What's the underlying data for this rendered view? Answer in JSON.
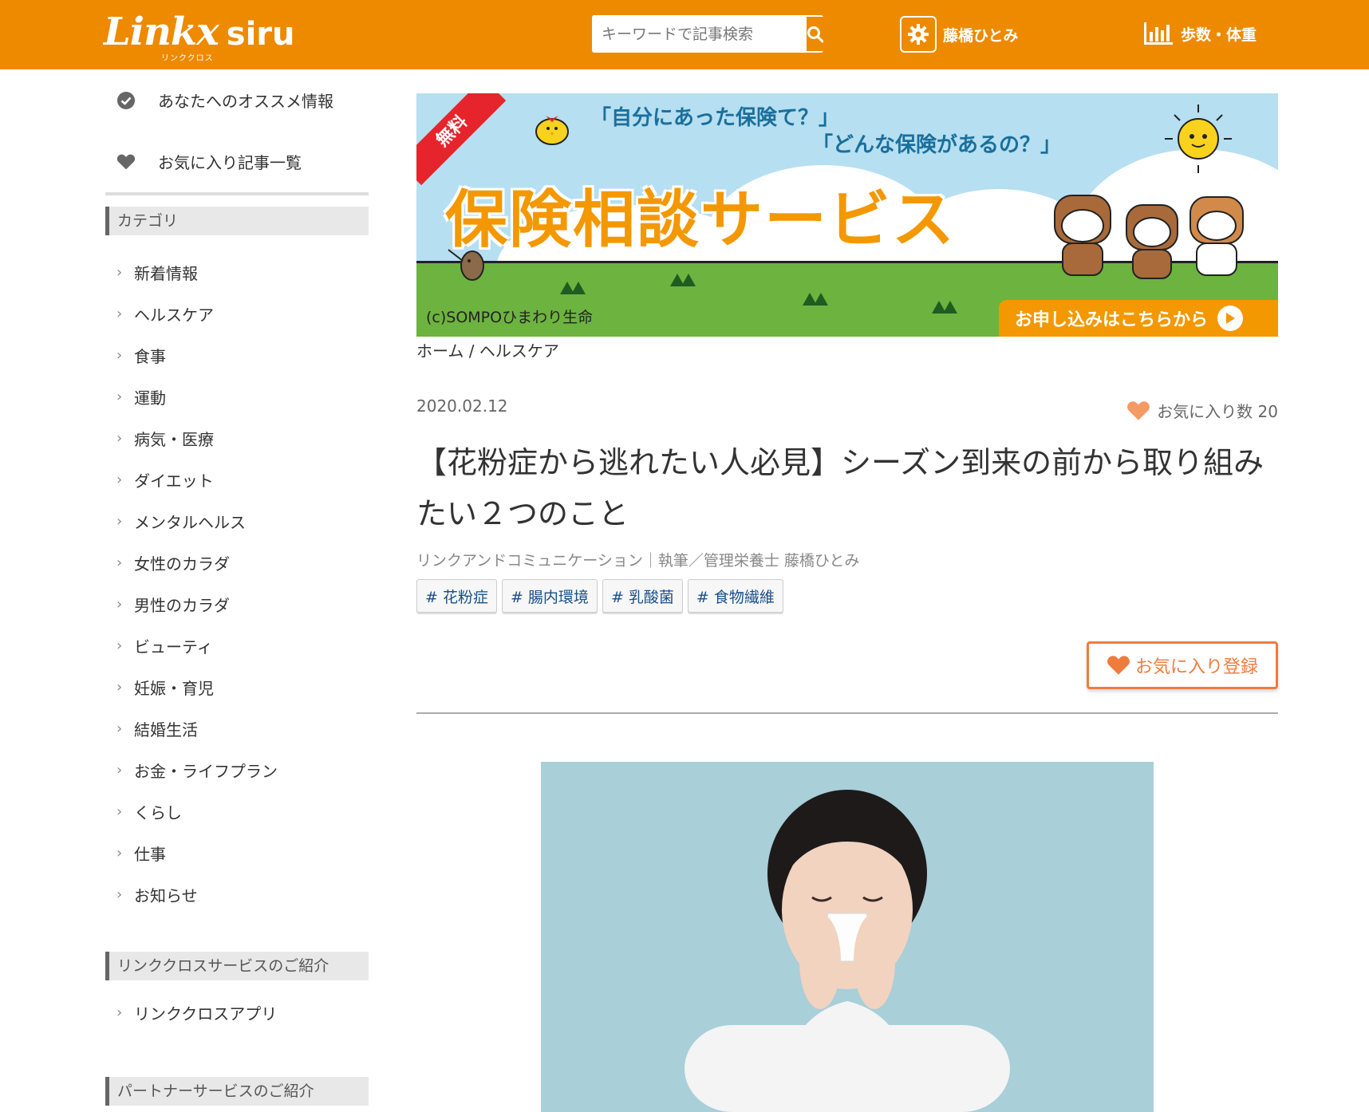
{
  "header": {
    "logo_main": "Linkx",
    "logo_siru": "siru",
    "logo_sub": "リンククロス",
    "search_placeholder": "キーワードで記事検索",
    "user_name": "藤橋ひとみ",
    "steps_label": "歩数・体重",
    "accent_color": "#ed8a00"
  },
  "sidebar": {
    "top_links": [
      {
        "label": "あなたへのオススメ情報",
        "icon": "check-circle-icon"
      },
      {
        "label": "お気に入り記事一覧",
        "icon": "heart-icon"
      }
    ],
    "category_heading": "カテゴリ",
    "categories": [
      "新着情報",
      "ヘルスケア",
      "食事",
      "運動",
      "病気・医療",
      "ダイエット",
      "メンタルヘルス",
      "女性のカラダ",
      "男性のカラダ",
      "ビューティ",
      "妊娠・育児",
      "結婚生活",
      "お金・ライフプラン",
      "くらし",
      "仕事",
      "お知らせ"
    ],
    "services_heading": "リンククロスサービスのご紹介",
    "services": [
      "リンククロスアプリ"
    ],
    "partner_heading": "パートナーサービスのご紹介"
  },
  "banner": {
    "ribbon": "無料",
    "question1": "「自分にあった保険て？」",
    "question2": "「どんな保険があるの？」",
    "title": "保険相談サービス",
    "copyright": "(c)SOMPOひまわり生命",
    "cta": "お申し込みはこちらから"
  },
  "article": {
    "breadcrumb": "ホーム / ヘルスケア",
    "date": "2020.02.12",
    "favorite_count_label": "お気に入り数 20",
    "title": "【花粉症から逃れたい人必見】シーズン到来の前から取り組みたい２つのこと",
    "author": "リンクアンドコミュニケーション｜執筆／管理栄養士 藤橋ひとみ",
    "tags": [
      "# 花粉症",
      "# 腸内環境",
      "# 乳酸菌",
      "# 食物繊維"
    ],
    "favorite_button": "お気に入り登録"
  }
}
